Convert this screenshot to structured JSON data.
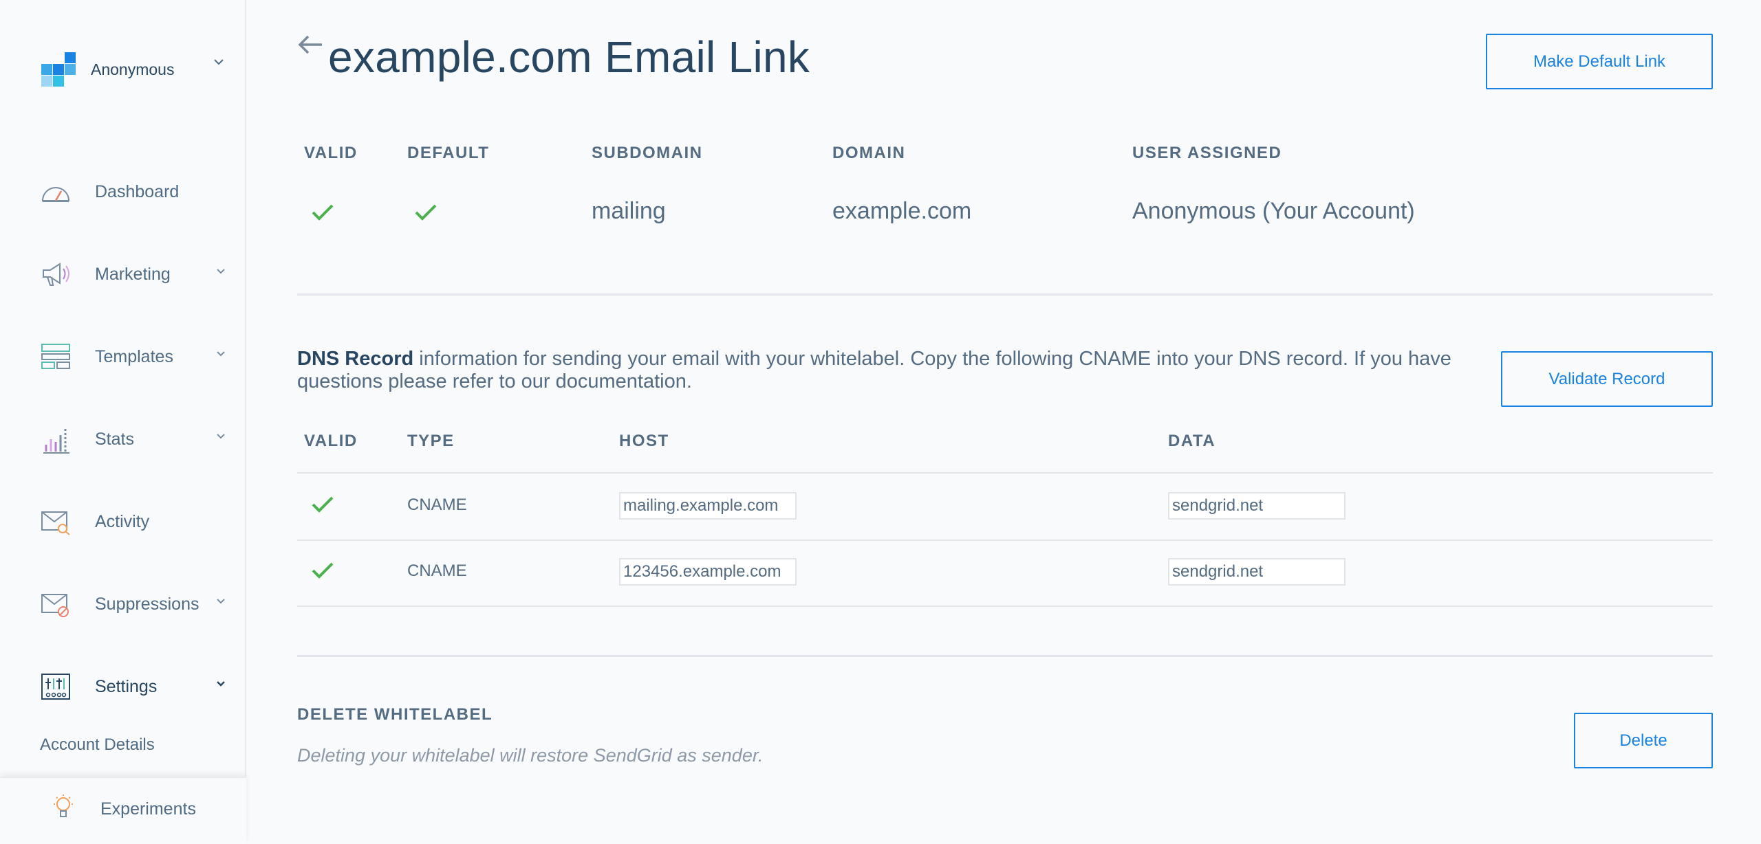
{
  "sidebar": {
    "account_name": "Anonymous",
    "nav": [
      {
        "label": "Dashboard",
        "icon": "dashboard-gauge-icon",
        "has_chevron": false
      },
      {
        "label": "Marketing",
        "icon": "megaphone-icon",
        "has_chevron": true
      },
      {
        "label": "Templates",
        "icon": "templates-icon",
        "has_chevron": true
      },
      {
        "label": "Stats",
        "icon": "stats-chart-icon",
        "has_chevron": true
      },
      {
        "label": "Activity",
        "icon": "activity-mail-search-icon",
        "has_chevron": false
      },
      {
        "label": "Suppressions",
        "icon": "suppressions-mail-block-icon",
        "has_chevron": true
      },
      {
        "label": "Settings",
        "icon": "settings-sliders-icon",
        "has_chevron": true,
        "active": true
      }
    ],
    "sub_item": "Account Details",
    "bottom_item": {
      "label": "Experiments",
      "icon": "lightbulb-icon"
    }
  },
  "header": {
    "title": "example.com Email Link",
    "make_default_button": "Make Default Link"
  },
  "summary": {
    "columns": [
      "VALID",
      "DEFAULT",
      "SUBDOMAIN",
      "DOMAIN",
      "USER ASSIGNED"
    ],
    "row": {
      "valid": true,
      "default": true,
      "subdomain": "mailing",
      "domain": "example.com",
      "user_assigned": "Anonymous (Your Account)"
    }
  },
  "dns": {
    "intro_bold": "DNS Record",
    "intro_text": " information for sending your email with your whitelabel. Copy the following CNAME into your DNS record. If you have questions please refer to our documentation.",
    "validate_button": "Validate Record",
    "columns": [
      "VALID",
      "TYPE",
      "HOST",
      "DATA"
    ],
    "rows": [
      {
        "valid": true,
        "type": "CNAME",
        "host": "mailing.example.com",
        "data": "sendgrid.net"
      },
      {
        "valid": true,
        "type": "CNAME",
        "host": "123456.example.com",
        "data": "sendgrid.net"
      }
    ]
  },
  "delete": {
    "title": "DELETE WHITELABEL",
    "note": "Deleting your whitelabel will restore SendGrid as sender.",
    "button": "Delete"
  },
  "colors": {
    "accent": "#1a82e2",
    "check": "#4cb04f",
    "text_dark": "#294661",
    "text_muted": "#546b81",
    "divider": "#e2e6ea"
  }
}
